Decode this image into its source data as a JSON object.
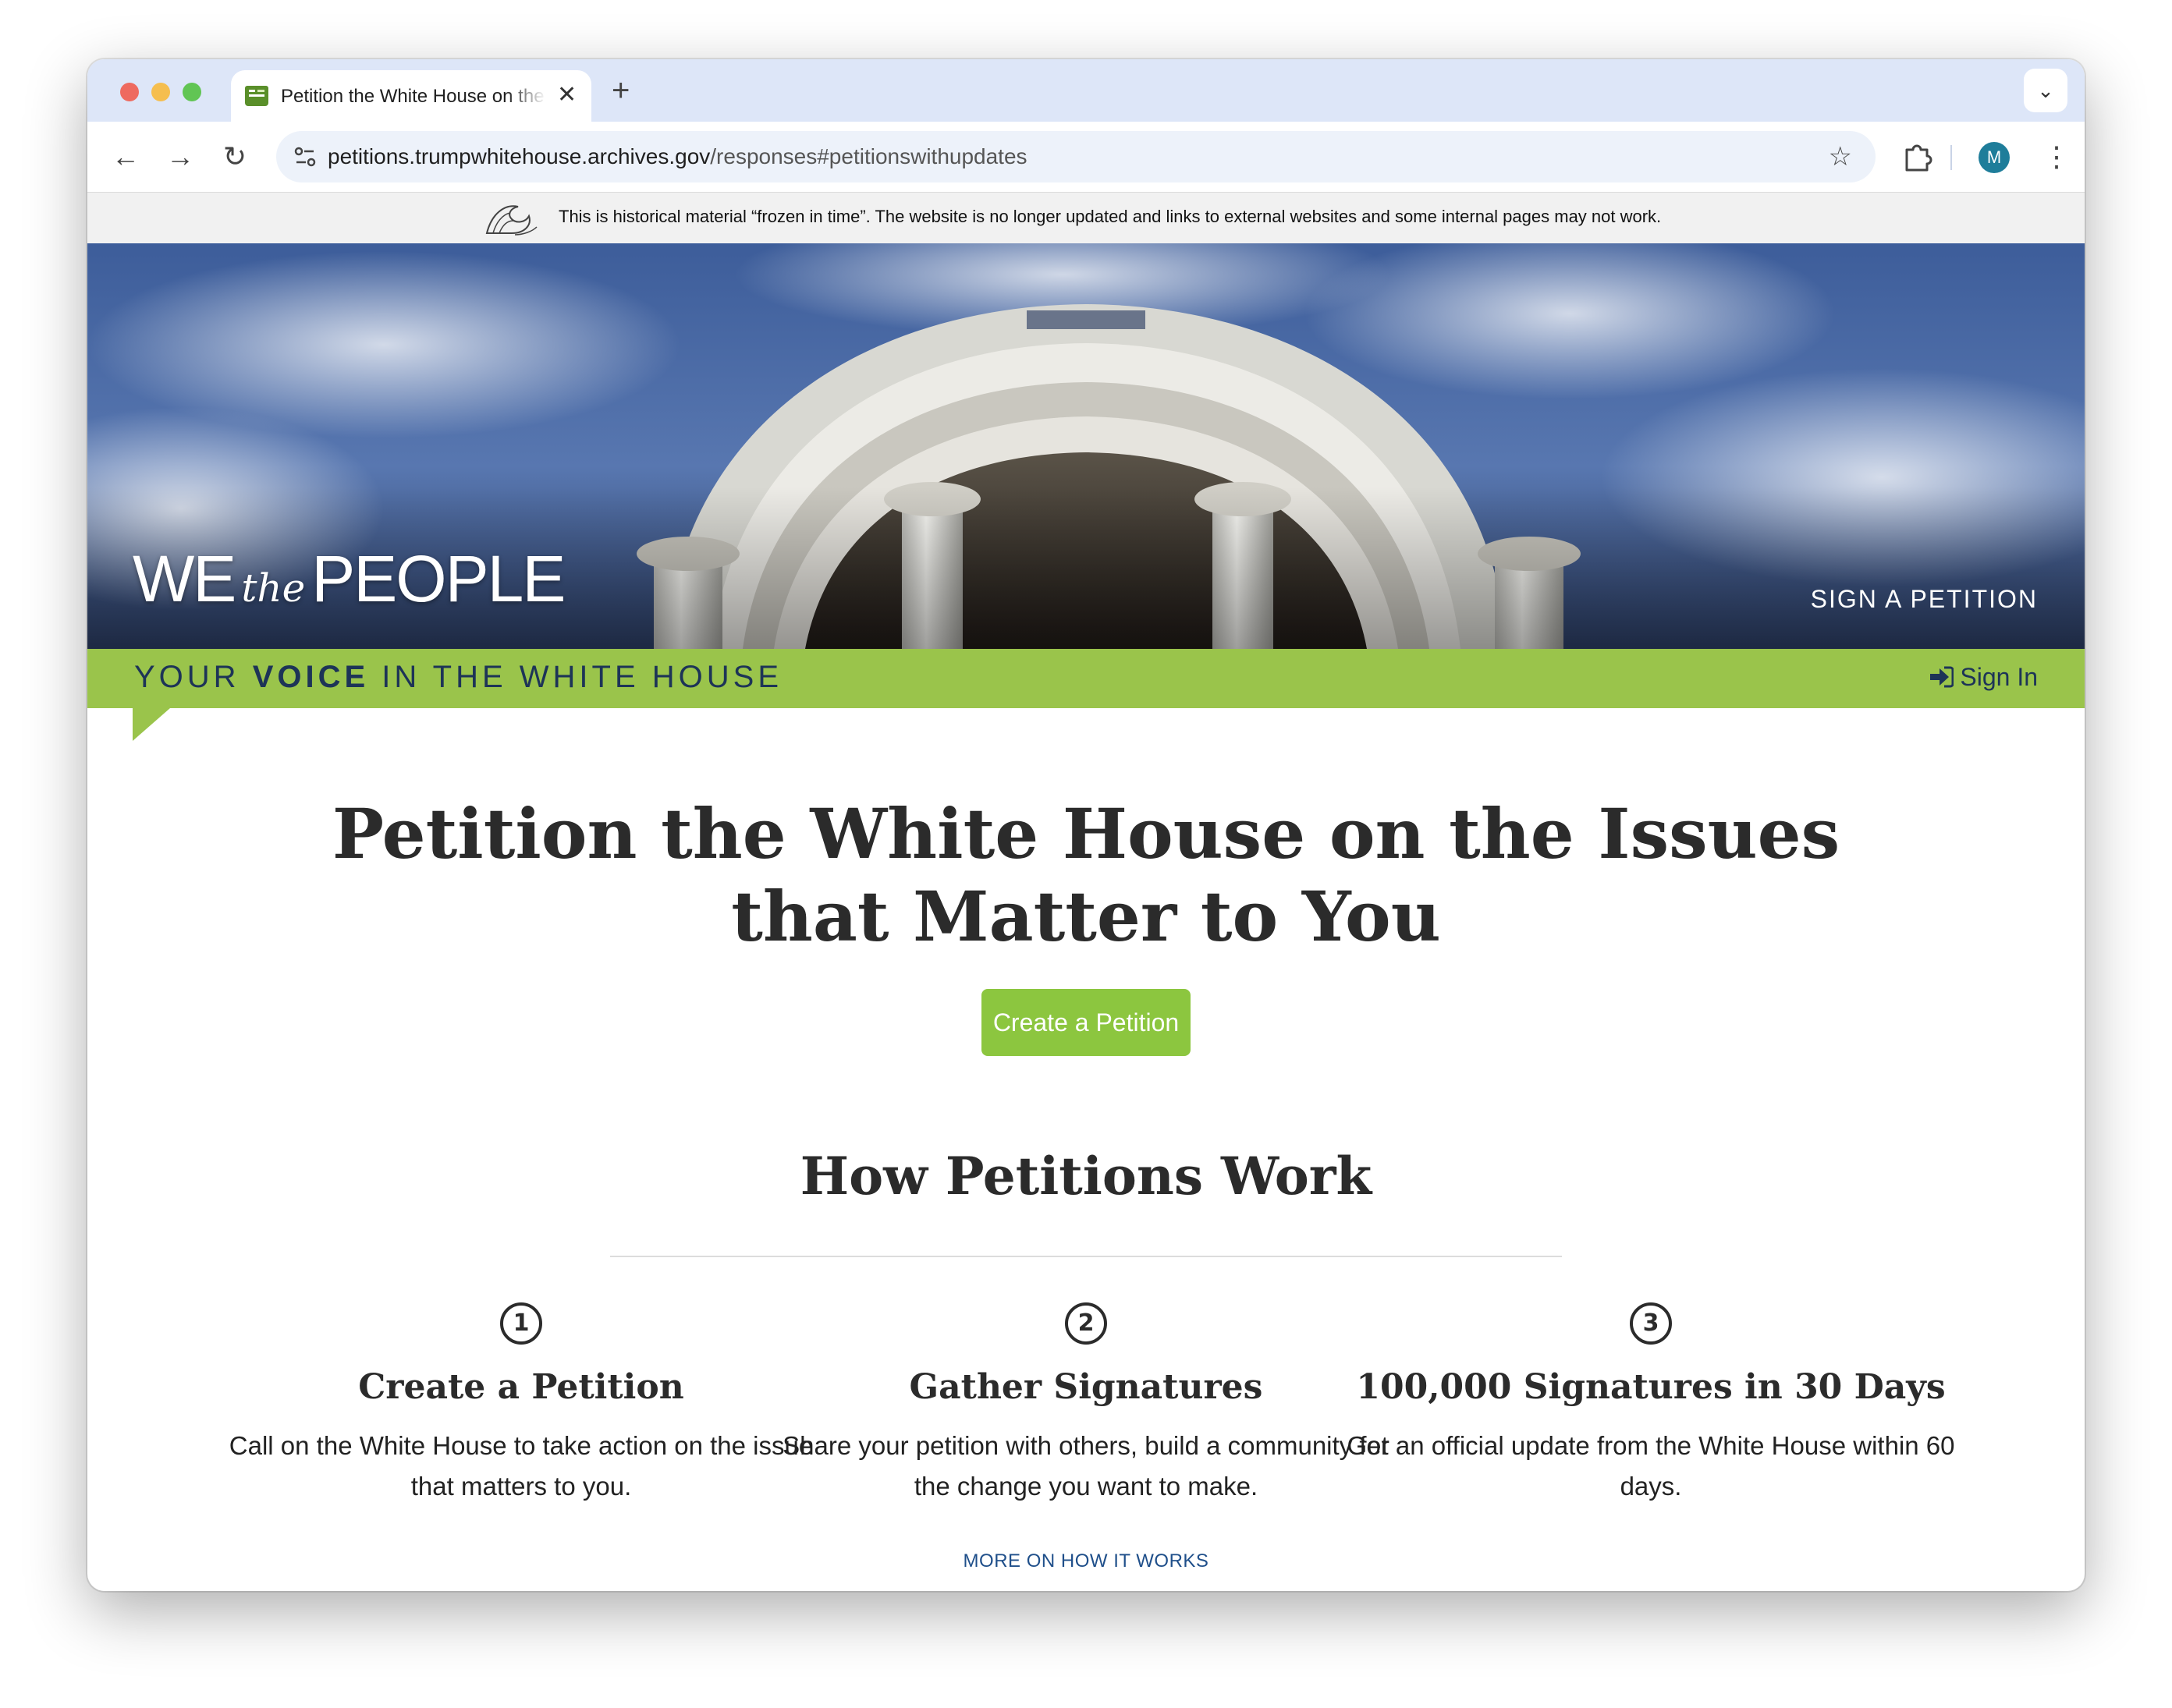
{
  "browser": {
    "tab_title": "Petition the White House on the Issues that Matter to You",
    "favicon_text": "WE the PEOPLE",
    "url_host": "petitions.trumpwhitehouse.archives.gov",
    "url_path": "/responses#petitionswithupdates",
    "profile_initial": "M",
    "icons": [
      "close-icon",
      "plus-icon",
      "chevron-down-icon",
      "back-icon",
      "forward-icon",
      "reload-icon",
      "site-settings-icon",
      "star-icon",
      "extensions-icon",
      "more-vert-icon"
    ]
  },
  "archive_banner": {
    "text": "This is historical material “frozen in time”. The website is no longer updated and links to external websites and some internal pages may not work."
  },
  "header": {
    "logo_we": "WE",
    "logo_the": "the",
    "logo_people": "PEOPLE",
    "sign_petition": "SIGN A PETITION",
    "tagline_pre": "YOUR ",
    "tagline_bold": "VOICE",
    "tagline_post": " IN THE WHITE HOUSE",
    "sign_in": "Sign In"
  },
  "main": {
    "title": "Petition the White House on the Issues that Matter to You",
    "create_button": "Create a Petition",
    "how_title": "How Petitions Work",
    "steps": [
      {
        "number": "1",
        "title": "Create a Petition",
        "description": "Call on the White House to take action on the issue that matters to you."
      },
      {
        "number": "2",
        "title": "Gather Signatures",
        "description": "Share your petition with others, build a community for the change you want to make."
      },
      {
        "number": "3",
        "title": "100,000 Signatures in 30 Days",
        "description": "Get an official update from the White House within 60 days."
      }
    ],
    "more_link": "MORE ON HOW IT WORKS"
  },
  "colors": {
    "accent_green": "#9ac44b",
    "button_green": "#8cc63f",
    "navy": "#1d3457",
    "link_blue": "#1f4f8a"
  }
}
